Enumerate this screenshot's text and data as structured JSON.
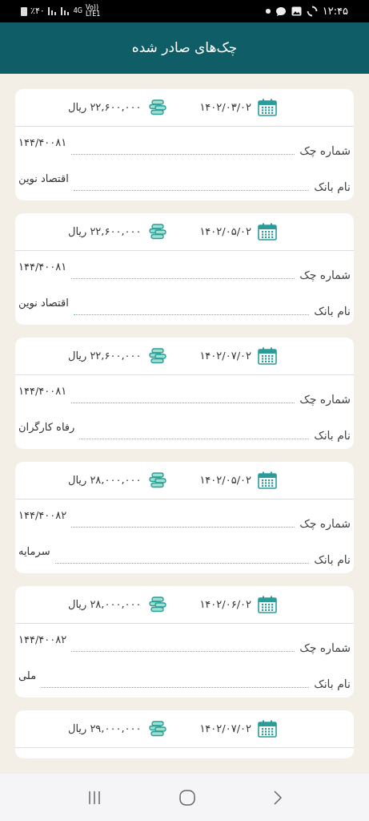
{
  "status_bar": {
    "battery": "٪۴۰",
    "network": "4G",
    "volte": "Vo)) LTE1",
    "time": "۱۲:۴۵"
  },
  "header": {
    "title": "چک‌های صادر شده"
  },
  "checks": [
    {
      "date": "۱۴۰۲/۰۳/۰۲",
      "amount": "۲۲,۶۰۰,۰۰۰ ریال",
      "fields": [
        {
          "label": "شماره چک",
          "value": "۱۴۴/۴۰۰۸۱"
        },
        {
          "label": "نام بانک",
          "value": "اقتصاد نوین"
        }
      ]
    },
    {
      "date": "۱۴۰۲/۰۵/۰۲",
      "amount": "۲۲,۶۰۰,۰۰۰ ریال",
      "fields": [
        {
          "label": "شماره چک",
          "value": "۱۴۴/۴۰۰۸۱"
        },
        {
          "label": "نام بانک",
          "value": "اقتصاد نوین"
        }
      ]
    },
    {
      "date": "۱۴۰۲/۰۷/۰۲",
      "amount": "۲۲,۶۰۰,۰۰۰ ریال",
      "fields": [
        {
          "label": "شماره چک",
          "value": "۱۴۴/۴۰۰۸۱"
        },
        {
          "label": "نام بانک",
          "value": "رفاه کارگران"
        }
      ]
    },
    {
      "date": "۱۴۰۲/۰۵/۰۲",
      "amount": "۲۸,۰۰۰,۰۰۰ ریال",
      "fields": [
        {
          "label": "شماره چک",
          "value": "۱۴۴/۴۰۰۸۲"
        },
        {
          "label": "نام بانک",
          "value": "سرمایه"
        }
      ]
    },
    {
      "date": "۱۴۰۲/۰۶/۰۲",
      "amount": "۲۸,۰۰۰,۰۰۰ ریال",
      "fields": [
        {
          "label": "شماره چک",
          "value": "۱۴۴/۴۰۰۸۲"
        },
        {
          "label": "نام بانک",
          "value": "ملی"
        }
      ]
    },
    {
      "date": "۱۴۰۲/۰۷/۰۲",
      "amount": "۲۹,۰۰۰,۰۰۰ ریال"
    }
  ]
}
